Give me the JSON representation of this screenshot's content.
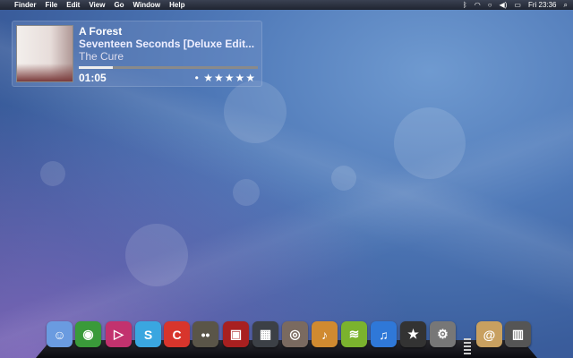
{
  "menubar": {
    "apple": "",
    "app": "Finder",
    "items": [
      "File",
      "Edit",
      "View",
      "Go",
      "Window",
      "Help"
    ],
    "status": {
      "bluetooth": "ᛒ",
      "wifi": "◠",
      "sync": "○",
      "volume": "◀)",
      "battery": "▭",
      "clock": "Fri 23:36",
      "search": "⌕"
    }
  },
  "now_playing": {
    "title": "A Forest",
    "album": "Seventeen Seconds [Deluxe Edit...",
    "artist": "The Cure",
    "elapsed": "01:05",
    "progress": 0.19,
    "rating_dot": "•",
    "rating": "★★★★★"
  },
  "dock": {
    "apps": [
      {
        "name": "finder",
        "glyph": "☺",
        "color": "#6a9be0"
      },
      {
        "name": "chrome",
        "glyph": "◉",
        "color": "#3a9a3a"
      },
      {
        "name": "itunes-radio",
        "glyph": "▷",
        "color": "#c2326e"
      },
      {
        "name": "skype",
        "glyph": "S",
        "color": "#3aa6e0"
      },
      {
        "name": "scrivener",
        "glyph": "C",
        "color": "#d8352c"
      },
      {
        "name": "gimp",
        "glyph": "••",
        "color": "#5a5548"
      },
      {
        "name": "photo-booth",
        "glyph": "▣",
        "color": "#a82020"
      },
      {
        "name": "radio",
        "glyph": "▦",
        "color": "#3c4046"
      },
      {
        "name": "djay",
        "glyph": "◎",
        "color": "#7a6a60"
      },
      {
        "name": "garageband",
        "glyph": "♪",
        "color": "#d08a30"
      },
      {
        "name": "spotify",
        "glyph": "≋",
        "color": "#7bb32e"
      },
      {
        "name": "itunes",
        "glyph": "♫",
        "color": "#2f78d8"
      },
      {
        "name": "imovie",
        "glyph": "★",
        "color": "#333"
      },
      {
        "name": "system-preferences",
        "glyph": "⚙",
        "color": "#777"
      },
      {
        "name": "mail-folder",
        "glyph": "@",
        "color": "#c8a060"
      },
      {
        "name": "trash",
        "glyph": "▥",
        "color": "#555"
      }
    ]
  }
}
